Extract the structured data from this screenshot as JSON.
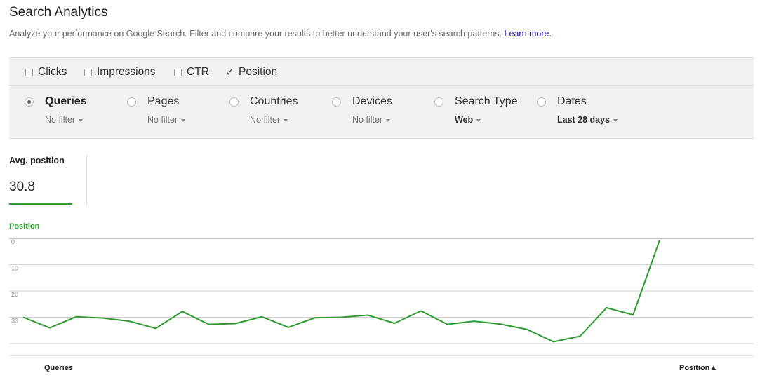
{
  "header": {
    "title": "Search Analytics",
    "description": "Analyze your performance on Google Search. Filter and compare your results to better understand your user's search patterns.",
    "learn_more": "Learn more."
  },
  "metrics": [
    {
      "label": "Clicks",
      "checked": false
    },
    {
      "label": "Impressions",
      "checked": false
    },
    {
      "label": "CTR",
      "checked": false
    },
    {
      "label": "Position",
      "checked": true
    }
  ],
  "check_glyph": "✓",
  "dimensions": [
    {
      "label": "Queries",
      "filter": "No filter",
      "selected": true
    },
    {
      "label": "Pages",
      "filter": "No filter",
      "selected": false
    },
    {
      "label": "Countries",
      "filter": "No filter",
      "selected": false
    },
    {
      "label": "Devices",
      "filter": "No filter",
      "selected": false
    },
    {
      "label": "Search Type",
      "filter": "Web",
      "selected": false
    },
    {
      "label": "Dates",
      "filter": "Last 28 days",
      "selected": false
    }
  ],
  "summary": {
    "label": "Avg. position",
    "value": "30.8",
    "accent_color": "#2e9b2e"
  },
  "chart_data": {
    "type": "line",
    "legend": "Position",
    "y_axis_reversed": true,
    "ylim": [
      0,
      40
    ],
    "y_ticks": [
      "0",
      "10",
      "20",
      "30"
    ],
    "grid": true,
    "series": [
      {
        "name": "Position",
        "color": "#2e9b2e",
        "values": [
          30,
          34,
          29.8,
          30.3,
          31.5,
          34.2,
          27.8,
          32.7,
          32.4,
          29.8,
          33.8,
          30.2,
          30,
          29.2,
          32.3,
          27.6,
          32.7,
          31.5,
          32.6,
          34.6,
          39.3,
          37.2,
          26.4,
          29.1,
          0.7
        ]
      }
    ]
  },
  "table": {
    "columns": [
      {
        "label": "Queries"
      },
      {
        "label": "Position▲"
      }
    ]
  }
}
